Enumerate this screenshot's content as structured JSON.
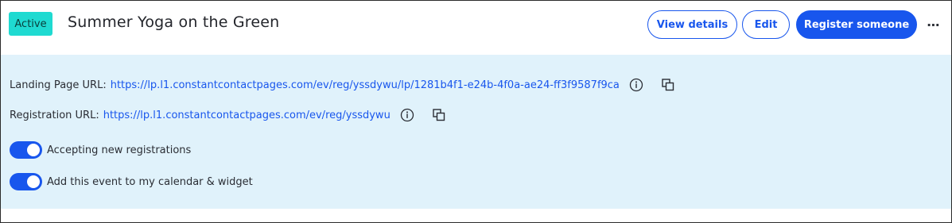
{
  "header": {
    "status_badge": "Active",
    "event_title": "Summer Yoga on the Green",
    "view_details_label": "View details",
    "edit_label": "Edit",
    "register_label": "Register someone",
    "more_label": "⋯"
  },
  "urls": {
    "landing": {
      "label": "Landing Page URL:",
      "url": "https://lp.l1.constantcontactpages.com/ev/reg/yssdywu/lp/1281b4f1-e24b-4f0a-ae24-ff3f9587f9ca"
    },
    "registration": {
      "label": "Registration URL:",
      "url": "https://lp.l1.constantcontactpages.com/ev/reg/yssdywu"
    }
  },
  "toggles": [
    {
      "label": "Accepting new registrations",
      "on": true
    },
    {
      "label": "Add this event to my calendar & widget",
      "on": true
    }
  ],
  "colors": {
    "accent": "#1856ed",
    "badge": "#1fdad1",
    "panel": "#e0f2fb"
  },
  "icons": {
    "info": "info-circle-icon",
    "copy": "copy-icon",
    "more": "more-horizontal-icon"
  }
}
